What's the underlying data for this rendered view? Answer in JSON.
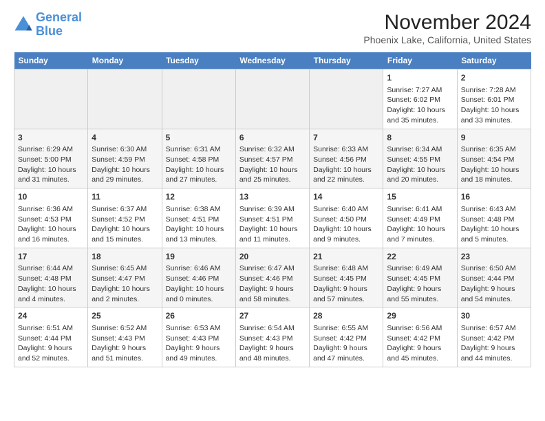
{
  "header": {
    "logo_line1": "General",
    "logo_line2": "Blue",
    "title": "November 2024",
    "subtitle": "Phoenix Lake, California, United States"
  },
  "calendar": {
    "days_of_week": [
      "Sunday",
      "Monday",
      "Tuesday",
      "Wednesday",
      "Thursday",
      "Friday",
      "Saturday"
    ],
    "weeks": [
      [
        {
          "day": "",
          "info": ""
        },
        {
          "day": "",
          "info": ""
        },
        {
          "day": "",
          "info": ""
        },
        {
          "day": "",
          "info": ""
        },
        {
          "day": "",
          "info": ""
        },
        {
          "day": "1",
          "info": "Sunrise: 7:27 AM\nSunset: 6:02 PM\nDaylight: 10 hours and 35 minutes."
        },
        {
          "day": "2",
          "info": "Sunrise: 7:28 AM\nSunset: 6:01 PM\nDaylight: 10 hours and 33 minutes."
        }
      ],
      [
        {
          "day": "3",
          "info": "Sunrise: 6:29 AM\nSunset: 5:00 PM\nDaylight: 10 hours and 31 minutes."
        },
        {
          "day": "4",
          "info": "Sunrise: 6:30 AM\nSunset: 4:59 PM\nDaylight: 10 hours and 29 minutes."
        },
        {
          "day": "5",
          "info": "Sunrise: 6:31 AM\nSunset: 4:58 PM\nDaylight: 10 hours and 27 minutes."
        },
        {
          "day": "6",
          "info": "Sunrise: 6:32 AM\nSunset: 4:57 PM\nDaylight: 10 hours and 25 minutes."
        },
        {
          "day": "7",
          "info": "Sunrise: 6:33 AM\nSunset: 4:56 PM\nDaylight: 10 hours and 22 minutes."
        },
        {
          "day": "8",
          "info": "Sunrise: 6:34 AM\nSunset: 4:55 PM\nDaylight: 10 hours and 20 minutes."
        },
        {
          "day": "9",
          "info": "Sunrise: 6:35 AM\nSunset: 4:54 PM\nDaylight: 10 hours and 18 minutes."
        }
      ],
      [
        {
          "day": "10",
          "info": "Sunrise: 6:36 AM\nSunset: 4:53 PM\nDaylight: 10 hours and 16 minutes."
        },
        {
          "day": "11",
          "info": "Sunrise: 6:37 AM\nSunset: 4:52 PM\nDaylight: 10 hours and 15 minutes."
        },
        {
          "day": "12",
          "info": "Sunrise: 6:38 AM\nSunset: 4:51 PM\nDaylight: 10 hours and 13 minutes."
        },
        {
          "day": "13",
          "info": "Sunrise: 6:39 AM\nSunset: 4:51 PM\nDaylight: 10 hours and 11 minutes."
        },
        {
          "day": "14",
          "info": "Sunrise: 6:40 AM\nSunset: 4:50 PM\nDaylight: 10 hours and 9 minutes."
        },
        {
          "day": "15",
          "info": "Sunrise: 6:41 AM\nSunset: 4:49 PM\nDaylight: 10 hours and 7 minutes."
        },
        {
          "day": "16",
          "info": "Sunrise: 6:43 AM\nSunset: 4:48 PM\nDaylight: 10 hours and 5 minutes."
        }
      ],
      [
        {
          "day": "17",
          "info": "Sunrise: 6:44 AM\nSunset: 4:48 PM\nDaylight: 10 hours and 4 minutes."
        },
        {
          "day": "18",
          "info": "Sunrise: 6:45 AM\nSunset: 4:47 PM\nDaylight: 10 hours and 2 minutes."
        },
        {
          "day": "19",
          "info": "Sunrise: 6:46 AM\nSunset: 4:46 PM\nDaylight: 10 hours and 0 minutes."
        },
        {
          "day": "20",
          "info": "Sunrise: 6:47 AM\nSunset: 4:46 PM\nDaylight: 9 hours and 58 minutes."
        },
        {
          "day": "21",
          "info": "Sunrise: 6:48 AM\nSunset: 4:45 PM\nDaylight: 9 hours and 57 minutes."
        },
        {
          "day": "22",
          "info": "Sunrise: 6:49 AM\nSunset: 4:45 PM\nDaylight: 9 hours and 55 minutes."
        },
        {
          "day": "23",
          "info": "Sunrise: 6:50 AM\nSunset: 4:44 PM\nDaylight: 9 hours and 54 minutes."
        }
      ],
      [
        {
          "day": "24",
          "info": "Sunrise: 6:51 AM\nSunset: 4:44 PM\nDaylight: 9 hours and 52 minutes."
        },
        {
          "day": "25",
          "info": "Sunrise: 6:52 AM\nSunset: 4:43 PM\nDaylight: 9 hours and 51 minutes."
        },
        {
          "day": "26",
          "info": "Sunrise: 6:53 AM\nSunset: 4:43 PM\nDaylight: 9 hours and 49 minutes."
        },
        {
          "day": "27",
          "info": "Sunrise: 6:54 AM\nSunset: 4:43 PM\nDaylight: 9 hours and 48 minutes."
        },
        {
          "day": "28",
          "info": "Sunrise: 6:55 AM\nSunset: 4:42 PM\nDaylight: 9 hours and 47 minutes."
        },
        {
          "day": "29",
          "info": "Sunrise: 6:56 AM\nSunset: 4:42 PM\nDaylight: 9 hours and 45 minutes."
        },
        {
          "day": "30",
          "info": "Sunrise: 6:57 AM\nSunset: 4:42 PM\nDaylight: 9 hours and 44 minutes."
        }
      ]
    ]
  }
}
